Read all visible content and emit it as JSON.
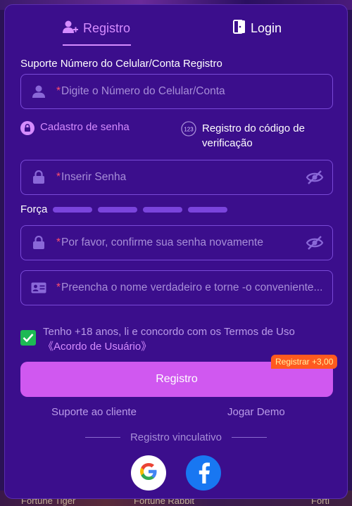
{
  "tabs": {
    "registro": "Registro",
    "login": "Login"
  },
  "form": {
    "section_label": "Suporte Número do Celular/Conta Registro",
    "phone_placeholder": "Digite o Número do Celular/Conta",
    "required_mark": "*",
    "option_password": "Cadastro de senha",
    "option_code_line1": "Registro do código de",
    "option_code_line2": "verificação",
    "password_placeholder": "Inserir Senha",
    "strength_label": "Força",
    "confirm_placeholder": "Por favor, confirme sua senha novamente",
    "realname_placeholder": "Preencha o nome verdadeiro e torne -o conveniente..."
  },
  "terms": {
    "checked": true,
    "text": "Tenho +18 anos, li e concordo com os Termos de Uso",
    "link": "《Acordo de Usuário》"
  },
  "register_button": {
    "label": "Registro",
    "bonus_badge": "Registrar +3,00"
  },
  "links": {
    "support": "Suporte ao cliente",
    "demo": "Jogar Demo"
  },
  "social": {
    "label": "Registro vinculativo",
    "providers": [
      "google-icon",
      "facebook-icon"
    ]
  },
  "background": {
    "games": [
      "Fortune Tiger",
      "Fortune Rabbit",
      "Forti"
    ]
  },
  "colors": {
    "panel": "#3b0e8c",
    "accent": "#d58cff",
    "button": "#d058f0",
    "checkbox": "#1db954",
    "badge": "#ff5a1f"
  }
}
